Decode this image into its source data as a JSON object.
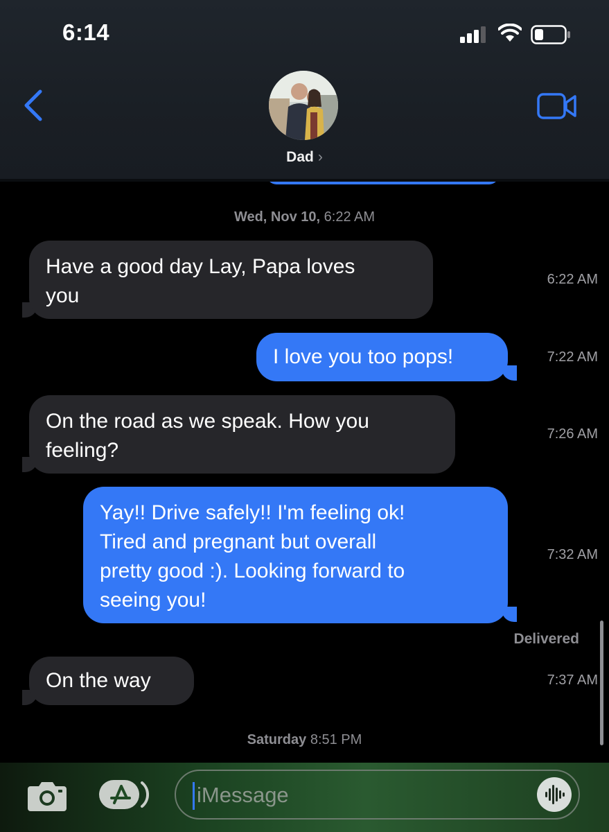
{
  "status_bar": {
    "time": "6:14"
  },
  "header": {
    "contact_name": "Dad",
    "chevron": "›"
  },
  "icons": {
    "back": "chevron-left-icon",
    "video": "video-camera-icon",
    "camera": "camera-icon",
    "apps": "app-store-icon",
    "voice": "waveform-icon",
    "signal": "cellular-signal-icon",
    "wifi": "wifi-icon",
    "battery": "battery-icon"
  },
  "thread": {
    "date_header_1": {
      "day": "Wed, Nov 10,",
      "time": "6:22 AM"
    },
    "messages": [
      {
        "direction": "in",
        "lines": [
          "Have a good day Lay, Papa loves",
          "you"
        ],
        "time": "6:22 AM"
      },
      {
        "direction": "out",
        "lines": [
          "I love you too pops!"
        ],
        "time": "7:22 AM"
      },
      {
        "direction": "in",
        "lines": [
          "On the road as we speak. How you",
          "feeling?"
        ],
        "time": "7:26 AM"
      },
      {
        "direction": "out",
        "lines": [
          "Yay!! Drive safely!!  I'm feeling ok!",
          "Tired and pregnant but overall",
          "pretty good :). Looking forward to",
          "seeing you!"
        ],
        "time": "7:32 AM"
      },
      {
        "direction": "in",
        "lines": [
          "On the way"
        ],
        "time": "7:37 AM"
      }
    ],
    "delivered_label": "Delivered",
    "date_header_2": {
      "day": "Saturday",
      "time": "8:51 PM"
    }
  },
  "composer": {
    "placeholder": "iMessage"
  },
  "colors": {
    "accent": "#3478f6",
    "incoming_bubble": "#26262a",
    "background": "#000000"
  }
}
